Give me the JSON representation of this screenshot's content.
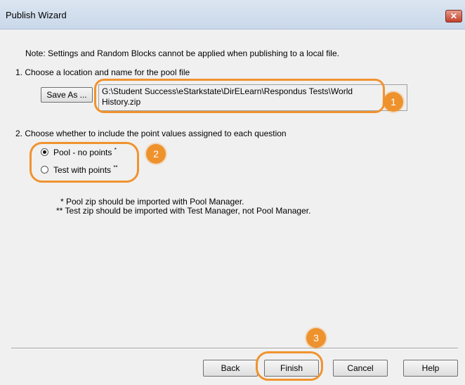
{
  "window": {
    "title": "Publish Wizard",
    "close_glyph": "✕"
  },
  "note": "Note: Settings and Random Blocks cannot be applied when publishing to a local file.",
  "step1": {
    "label": "1.  Choose a location and name for the pool file",
    "save_as_label": "Save As ...",
    "path_line1": "G:\\Student Success\\eStarkstate\\DirELearn\\Respondus Tests\\World",
    "path_line2": "History.zip"
  },
  "step2": {
    "label": "2.  Choose whether to include the point values assigned to each question",
    "options": [
      {
        "label": "Pool - no points",
        "marker": "*",
        "checked": true
      },
      {
        "label": "Test with points",
        "marker": "**",
        "checked": false
      }
    ],
    "footnote1": "* Pool zip should be imported with Pool Manager.",
    "footnote2": "** Test zip should be imported with Test Manager, not Pool Manager."
  },
  "buttons": {
    "back": "Back",
    "finish": "Finish",
    "cancel": "Cancel",
    "help": "Help"
  },
  "annotations": {
    "badge1": "1",
    "badge2": "2",
    "badge3": "3",
    "accent_color": "#ee922d"
  }
}
